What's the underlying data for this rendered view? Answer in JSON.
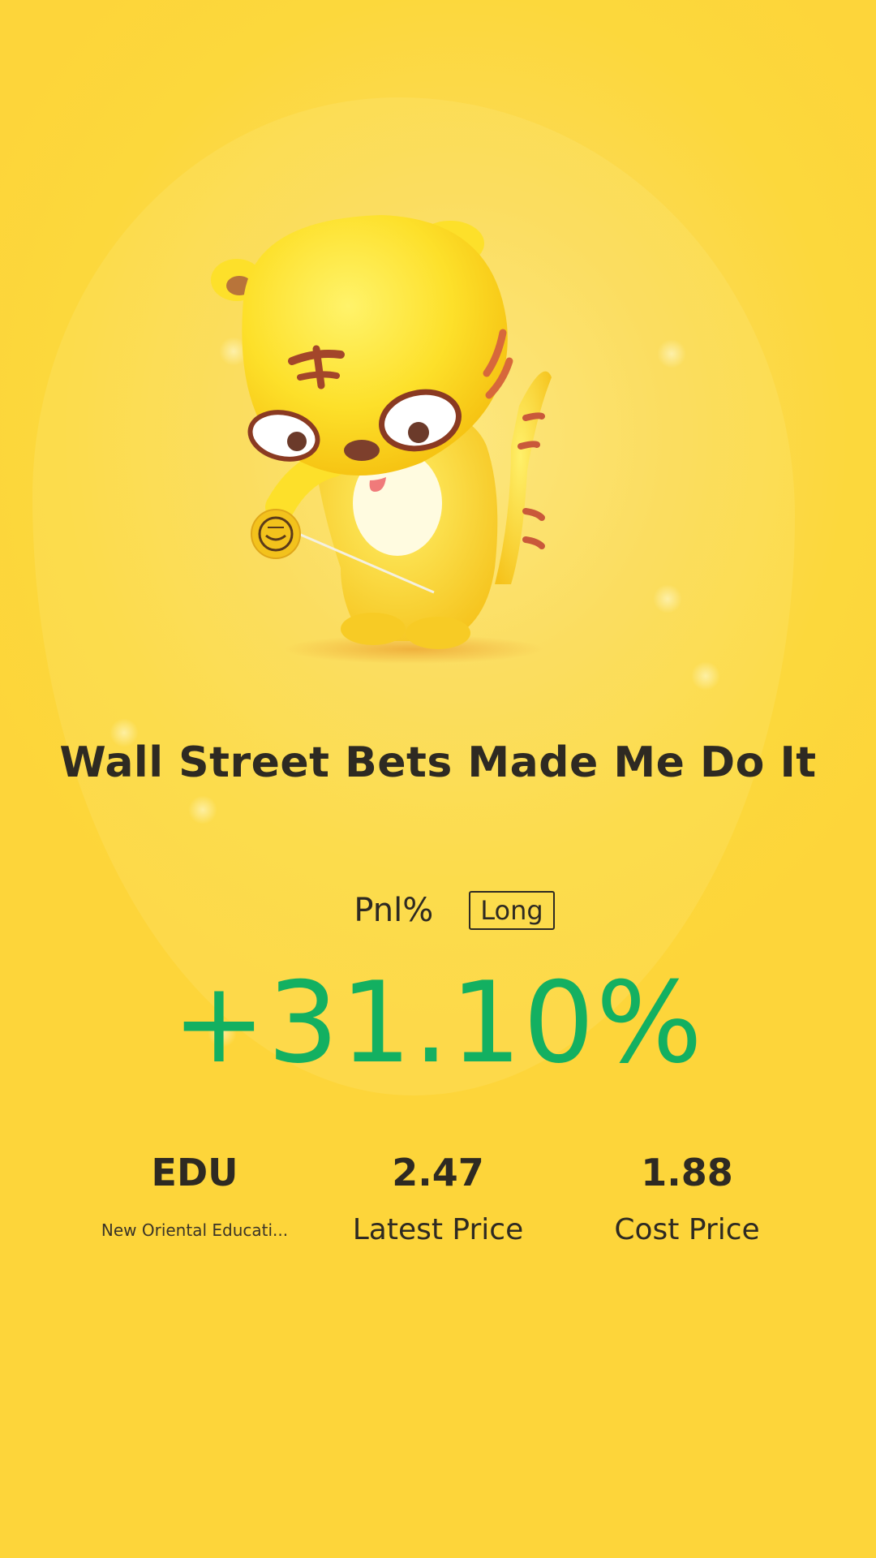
{
  "title": "Wall Street Bets Made Me Do It",
  "pnl": {
    "label": "Pnl%",
    "direction": "Long",
    "value": "+31.10%",
    "color": "#13b061"
  },
  "stats": [
    {
      "value": "EDU",
      "label": "New Oriental Educati..."
    },
    {
      "value": "2.47",
      "label": "Latest Price"
    },
    {
      "value": "1.88",
      "label": "Cost Price"
    }
  ],
  "mascot": {
    "icon": "tiger-mascot-with-yoyo"
  },
  "colors": {
    "background": "#fcd83c",
    "text": "#2e2a22",
    "profit": "#13b061"
  }
}
